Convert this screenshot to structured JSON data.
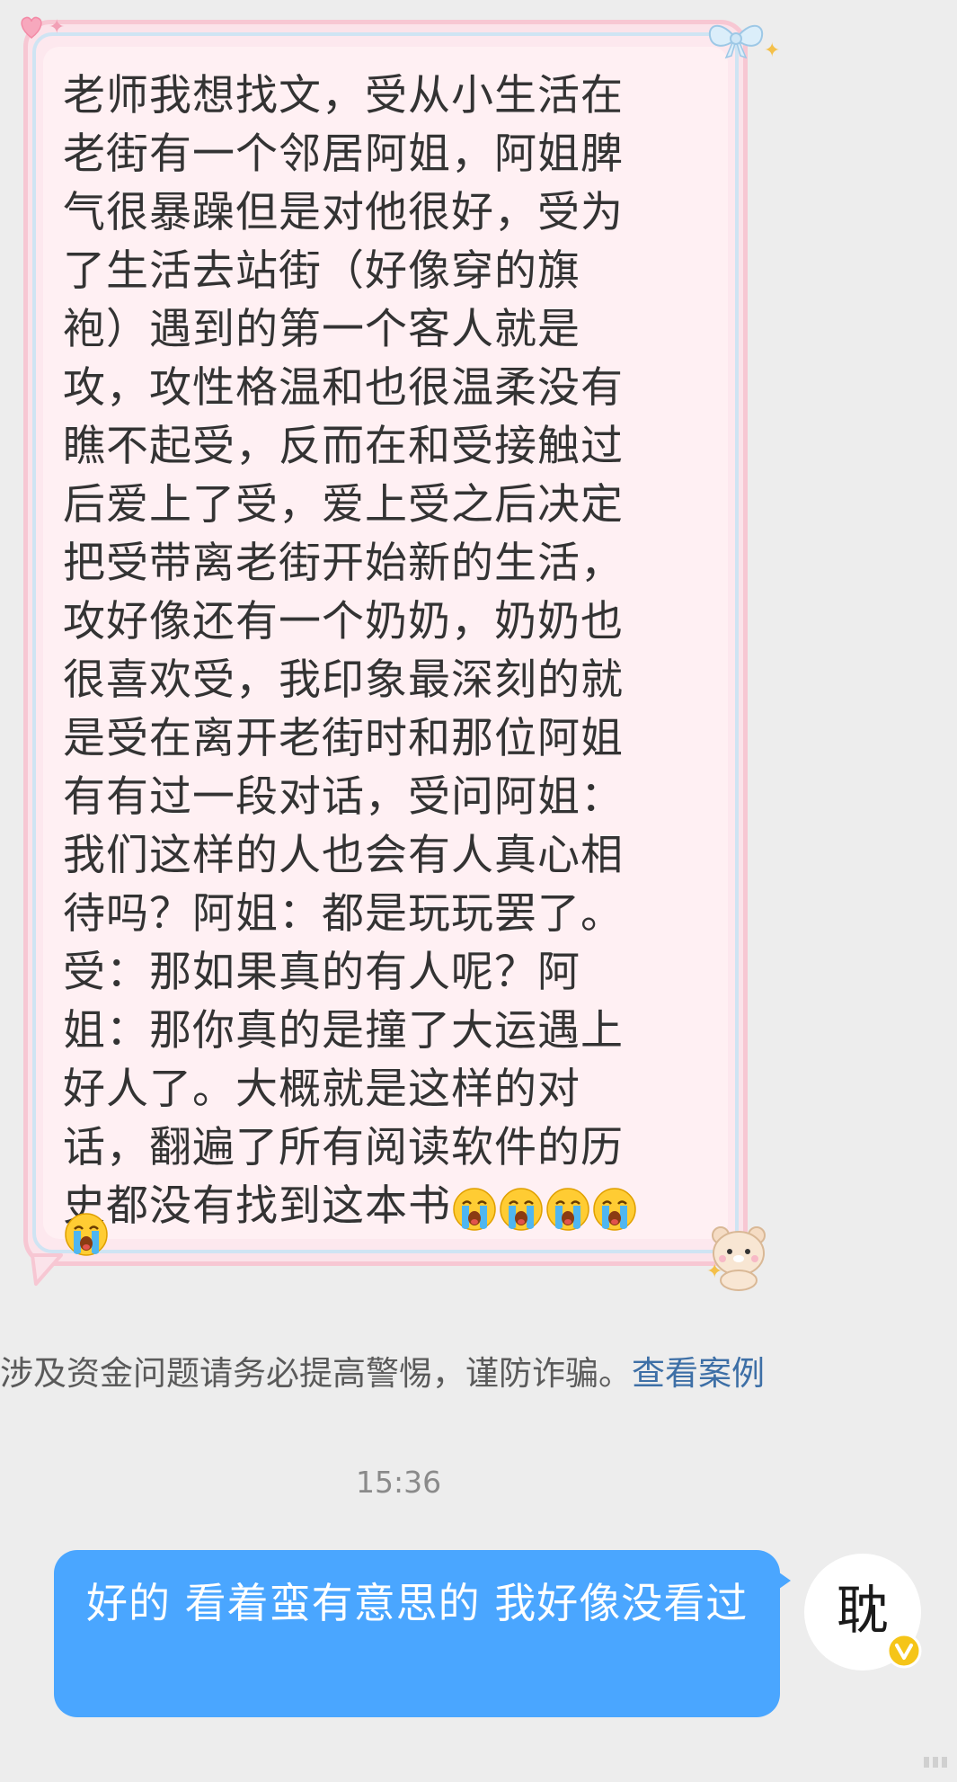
{
  "incoming": {
    "text": "老师我想找文，受从小生活在\n老街有一个邻居阿姐，阿姐脾\n气很暴躁但是对他很好，受为\n了生活去站街（好像穿的旗\n袍）遇到的第一个客人就是\n攻，攻性格温和也很温柔没有\n瞧不起受，反而在和受接触过\n后爱上了受，爱上受之后决定\n把受带离老街开始新的生活，\n攻好像还有一个奶奶，奶奶也\n很喜欢受，我印象最深刻的就\n是受在离开老街时和那位阿姐\n有有过一段对话，受问阿姐：\n我们这样的人也会有人真心相\n待吗？阿姐：都是玩玩罢了。\n受：那如果真的有人呢？阿\n姐：那你真的是撞了大运遇上\n好人了。大概就是这样的对\n话，翻遍了所有阅读软件的历\n史都没有找到这本书",
    "emoji_icon": "loudly-crying-face-icon",
    "emoji_count": 5
  },
  "notice": {
    "text": "涉及资金问题请务必提高警惕，谨防诈骗。",
    "link": "查看案例"
  },
  "timestamp": "15:36",
  "outgoing": {
    "text": "好的 看着蛮有意思的 我好像没看过"
  },
  "avatar": {
    "char": "耽"
  },
  "colors": {
    "background": "#ededed",
    "incoming_bubble": "#fff0f3",
    "outgoing_bubble": "#4aa6ff",
    "link": "#3d6fa6",
    "verified_badge": "#f5c518"
  }
}
